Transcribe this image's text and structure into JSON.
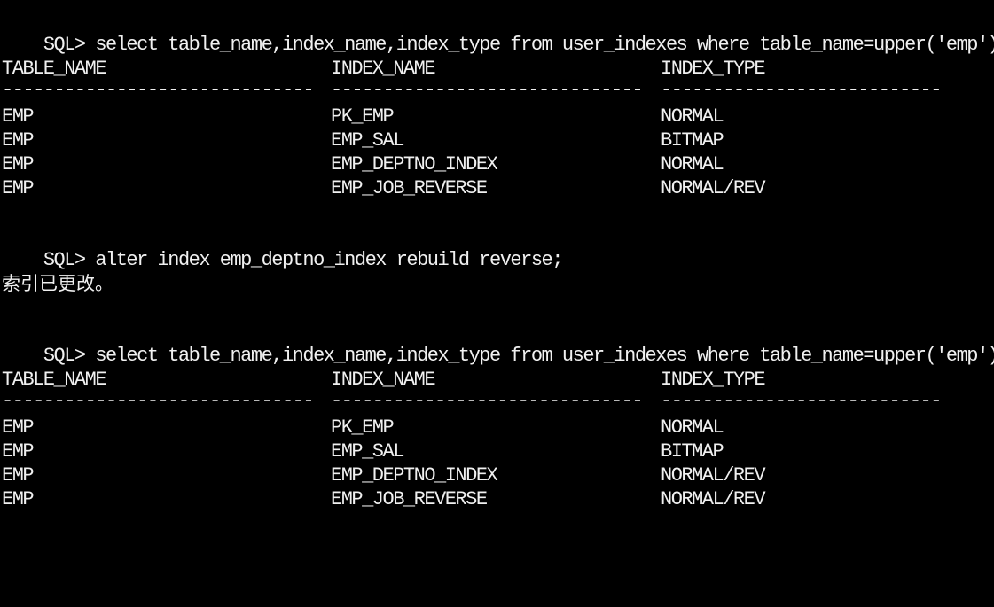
{
  "prompt": "SQL>",
  "query1": {
    "command": "select table_name,index_name,index_type from user_indexes where table_name=upper('emp');",
    "headers": [
      "TABLE_NAME",
      "INDEX_NAME",
      "INDEX_TYPE"
    ],
    "separators": [
      "------------------------------",
      "------------------------------",
      "---------------------------"
    ],
    "rows": [
      [
        "EMP",
        "PK_EMP",
        "NORMAL"
      ],
      [
        "EMP",
        "EMP_SAL",
        "BITMAP"
      ],
      [
        "EMP",
        "EMP_DEPTNO_INDEX",
        "NORMAL"
      ],
      [
        "EMP",
        "EMP_JOB_REVERSE",
        "NORMAL/REV"
      ]
    ]
  },
  "alter": {
    "command": "alter index emp_deptno_index rebuild reverse;",
    "result": "索引已更改。"
  },
  "query2": {
    "command": "select table_name,index_name,index_type from user_indexes where table_name=upper('emp');",
    "headers": [
      "TABLE_NAME",
      "INDEX_NAME",
      "INDEX_TYPE"
    ],
    "separators": [
      "------------------------------",
      "------------------------------",
      "---------------------------"
    ],
    "rows": [
      [
        "EMP",
        "PK_EMP",
        "NORMAL"
      ],
      [
        "EMP",
        "EMP_SAL",
        "BITMAP"
      ],
      [
        "EMP",
        "EMP_DEPTNO_INDEX",
        "NORMAL/REV"
      ],
      [
        "EMP",
        "EMP_JOB_REVERSE",
        "NORMAL/REV"
      ]
    ]
  }
}
